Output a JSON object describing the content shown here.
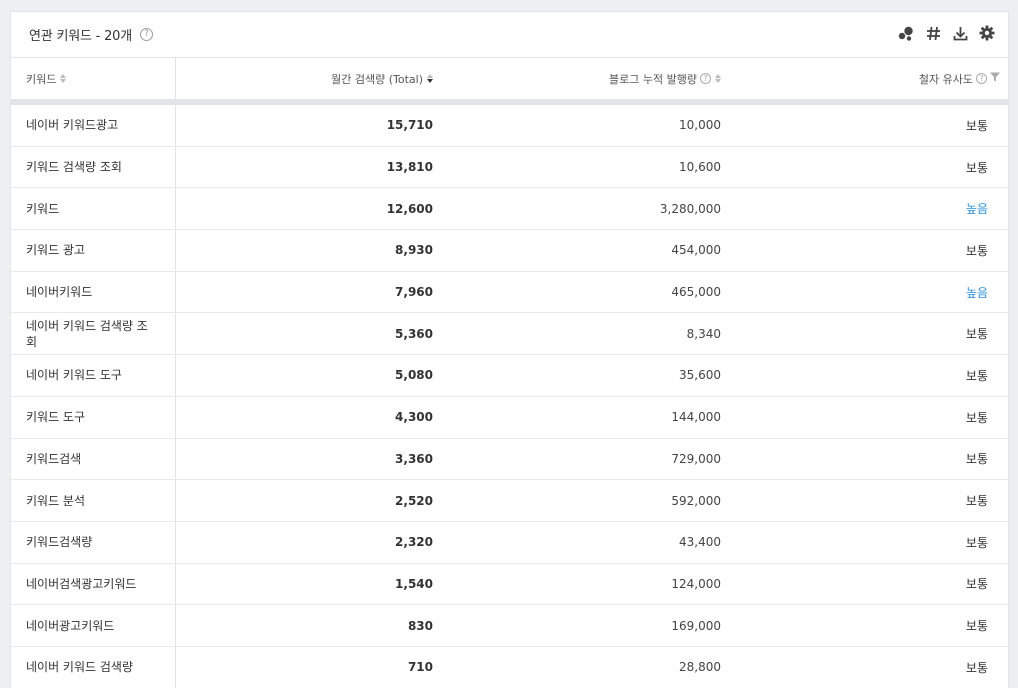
{
  "panel": {
    "title": "연관 키워드 - 20개",
    "help": "?"
  },
  "toolbar": {
    "icons": [
      "bubble-chart-icon",
      "hashtag-icon",
      "download-icon",
      "gear-icon"
    ]
  },
  "columns": {
    "keyword": "키워드",
    "monthly_search": "월간 검색량 (Total)",
    "blog_posts": "블로그 누적 발행량",
    "similarity": "철자 유사도"
  },
  "colors": {
    "high_similarity": "#2b8fd6",
    "background": "#eeeff1"
  },
  "rows": [
    {
      "keyword": "네이버 키워드광고",
      "search": "15,710",
      "blog": "10,000",
      "similarity": "보통",
      "high": false
    },
    {
      "keyword": "키워드 검색량 조회",
      "search": "13,810",
      "blog": "10,600",
      "similarity": "보통",
      "high": false
    },
    {
      "keyword": "키워드",
      "search": "12,600",
      "blog": "3,280,000",
      "similarity": "높음",
      "high": true
    },
    {
      "keyword": "키워드 광고",
      "search": "8,930",
      "blog": "454,000",
      "similarity": "보통",
      "high": false
    },
    {
      "keyword": "네이버키워드",
      "search": "7,960",
      "blog": "465,000",
      "similarity": "높음",
      "high": true
    },
    {
      "keyword": "네이버 키워드 검색량 조회",
      "search": "5,360",
      "blog": "8,340",
      "similarity": "보통",
      "high": false
    },
    {
      "keyword": "네이버 키워드 도구",
      "search": "5,080",
      "blog": "35,600",
      "similarity": "보통",
      "high": false
    },
    {
      "keyword": "키워드 도구",
      "search": "4,300",
      "blog": "144,000",
      "similarity": "보통",
      "high": false
    },
    {
      "keyword": "키워드검색",
      "search": "3,360",
      "blog": "729,000",
      "similarity": "보통",
      "high": false
    },
    {
      "keyword": "키워드 분석",
      "search": "2,520",
      "blog": "592,000",
      "similarity": "보통",
      "high": false
    },
    {
      "keyword": "키워드검색량",
      "search": "2,320",
      "blog": "43,400",
      "similarity": "보통",
      "high": false
    },
    {
      "keyword": "네이버검색광고키워드",
      "search": "1,540",
      "blog": "124,000",
      "similarity": "보통",
      "high": false
    },
    {
      "keyword": "네이버광고키워드",
      "search": "830",
      "blog": "169,000",
      "similarity": "보통",
      "high": false
    },
    {
      "keyword": "네이버 키워드 검색량",
      "search": "710",
      "blog": "28,800",
      "similarity": "보통",
      "high": false
    }
  ]
}
